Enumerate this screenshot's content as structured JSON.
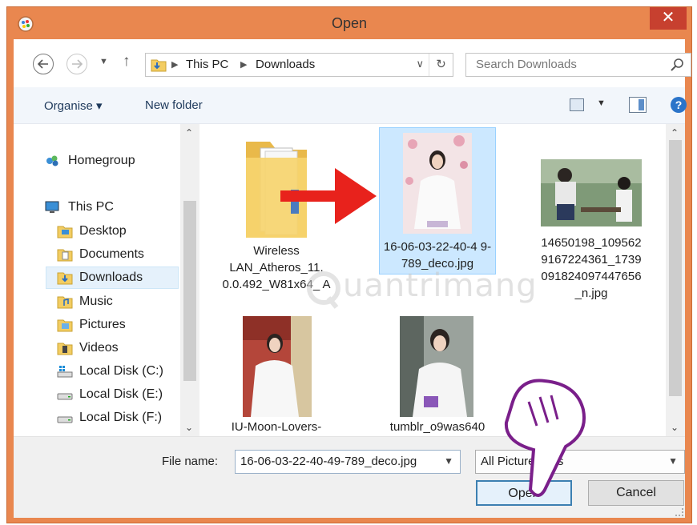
{
  "window": {
    "title": "Open",
    "close_glyph": "✕"
  },
  "address": {
    "crumbs": [
      "This PC",
      "Downloads"
    ],
    "search_placeholder": "Search Downloads"
  },
  "toolbar": {
    "organise": "Organise ▾",
    "new_folder": "New folder"
  },
  "nav": {
    "items": [
      {
        "label": "Homegroup",
        "icon": "homegroup-icon"
      },
      {
        "label": "This PC",
        "icon": "computer-icon"
      },
      {
        "label": "Desktop",
        "icon": "desktop-folder-icon"
      },
      {
        "label": "Documents",
        "icon": "documents-folder-icon"
      },
      {
        "label": "Downloads",
        "icon": "downloads-folder-icon",
        "selected": true
      },
      {
        "label": "Music",
        "icon": "music-folder-icon"
      },
      {
        "label": "Pictures",
        "icon": "pictures-folder-icon"
      },
      {
        "label": "Videos",
        "icon": "videos-folder-icon"
      },
      {
        "label": "Local Disk (C:)",
        "icon": "windows-drive-icon"
      },
      {
        "label": "Local Disk (E:)",
        "icon": "drive-icon"
      },
      {
        "label": "Local Disk (F:)",
        "icon": "drive-icon"
      }
    ]
  },
  "files": [
    {
      "label": "Wireless LAN_Atheros_11. 0.0.492_W81x64_ A",
      "kind": "folder"
    },
    {
      "label": "16-06-03-22-40-4 9-789_deco.jpg",
      "kind": "image",
      "selected": true
    },
    {
      "label": "14650198_109562 9167224361_1739 091824097447656 _n.jpg",
      "kind": "image"
    },
    {
      "label": "IU-Moon-Lovers-",
      "kind": "image"
    },
    {
      "label": "tumblr_o9was640",
      "kind": "image"
    }
  ],
  "bottom": {
    "file_name_label": "File name:",
    "file_name_value": "16-06-03-22-40-49-789_deco.jpg",
    "filter_value": "All Picture Files",
    "open_label": "Open",
    "cancel_label": "Cancel"
  },
  "watermark": {
    "text": "uantrimang"
  },
  "colors": {
    "title_bar": "#e9874f",
    "close": "#c7402f",
    "selection": "#cce8ff",
    "arrow": "#e8221c"
  }
}
